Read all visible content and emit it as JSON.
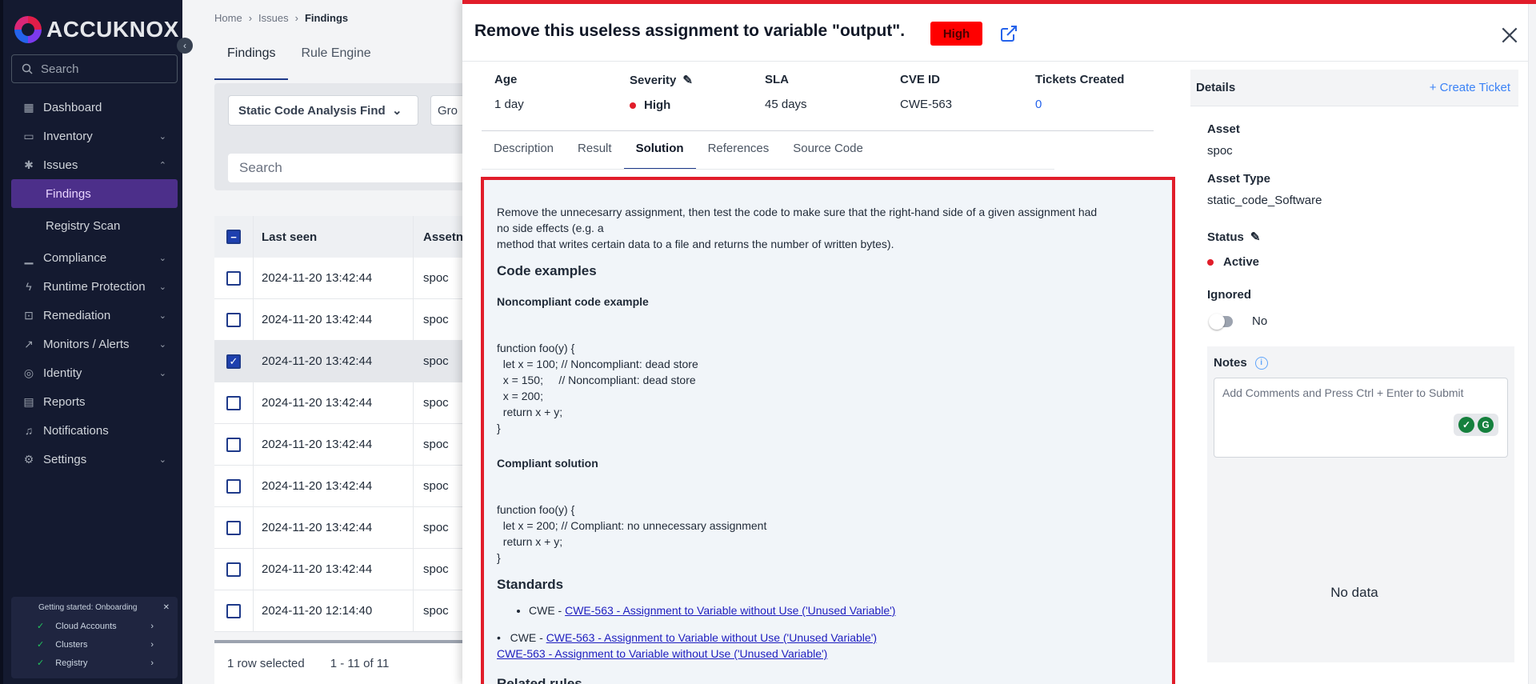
{
  "sidebar": {
    "logo": "ACCUKNOX",
    "search_placeholder": "Search",
    "items": [
      {
        "label": "Dashboard",
        "icon": "grid-icon"
      },
      {
        "label": "Inventory",
        "icon": "inventory-icon"
      },
      {
        "label": "Issues",
        "icon": "bug-icon"
      },
      {
        "label": "Findings",
        "icon": ""
      },
      {
        "label": "Registry Scan",
        "icon": ""
      },
      {
        "label": "Compliance",
        "icon": "chart-icon"
      },
      {
        "label": "Runtime Protection",
        "icon": "shield-icon"
      },
      {
        "label": "Remediation",
        "icon": "wrench-icon"
      },
      {
        "label": "Monitors / Alerts",
        "icon": "monitor-icon"
      },
      {
        "label": "Identity",
        "icon": "fingerprint-icon"
      },
      {
        "label": "Reports",
        "icon": "report-icon"
      },
      {
        "label": "Notifications",
        "icon": "bell-icon"
      },
      {
        "label": "Settings",
        "icon": "gear-icon"
      }
    ],
    "onboarding": {
      "title": "Getting started: Onboarding",
      "items": [
        "Cloud Accounts",
        "Clusters",
        "Registry"
      ]
    }
  },
  "page": {
    "breadcrumb": [
      "Home",
      "Issues",
      "Findings"
    ],
    "tabs": [
      "Findings",
      "Rule Engine"
    ],
    "filter": "Static Code Analysis Find",
    "filter2": "Gro",
    "search_placeholder": "Search",
    "columns": [
      "Last seen",
      "Assetn"
    ],
    "rows": [
      {
        "date": "2024-11-20 13:42:44",
        "asset": "spoc",
        "checked": false
      },
      {
        "date": "2024-11-20 13:42:44",
        "asset": "spoc",
        "checked": false
      },
      {
        "date": "2024-11-20 13:42:44",
        "asset": "spoc",
        "checked": true
      },
      {
        "date": "2024-11-20 13:42:44",
        "asset": "spoc",
        "checked": false
      },
      {
        "date": "2024-11-20 13:42:44",
        "asset": "spoc",
        "checked": false
      },
      {
        "date": "2024-11-20 13:42:44",
        "asset": "spoc",
        "checked": false
      },
      {
        "date": "2024-11-20 13:42:44",
        "asset": "spoc",
        "checked": false
      },
      {
        "date": "2024-11-20 13:42:44",
        "asset": "spoc",
        "checked": false
      },
      {
        "date": "2024-11-20 12:14:40",
        "asset": "spoc",
        "checked": false
      }
    ],
    "footer_selected": "1 row selected",
    "footer_range": "1 - 11 of 11"
  },
  "drawer": {
    "title": "Remove this useless assignment to variable \"output\".",
    "severity_badge": "High",
    "meta": {
      "age_label": "Age",
      "age": "1 day",
      "severity_label": "Severity",
      "severity": "High",
      "sla_label": "SLA",
      "sla": "45 days",
      "cve_label": "CVE ID",
      "cve": "CWE-563",
      "tickets_label": "Tickets Created",
      "tickets": "0"
    },
    "tabs": [
      "Description",
      "Result",
      "Solution",
      "References",
      "Source Code"
    ],
    "active_tab": "Solution",
    "solution": {
      "intro_1": "Remove the unnecesarry assignment, then test the code to make sure that the right-hand side of a given assignment had no side effects (e.g. a",
      "intro_2": "method that writes certain data to a file and returns the number of written bytes).",
      "h_code": "Code examples",
      "h_noncompliant": "Noncompliant code example",
      "code_noncompliant": "function foo(y) {\n  let x = 100; // Noncompliant: dead store\n  x = 150;     // Noncompliant: dead store\n  x = 200;\n  return x + y;\n}",
      "h_compliant": "Compliant solution",
      "code_compliant": "function foo(y) {\n  let x = 200; // Compliant: no unnecessary assignment\n  return x + y;\n}",
      "h_standards": "Standards",
      "std_prefix": "CWE - ",
      "std_link": "CWE-563 - Assignment to Variable without Use ('Unused Variable')",
      "h_related": "Related rules"
    },
    "details": {
      "title": "Details",
      "create_ticket": "+ Create Ticket",
      "asset_label": "Asset",
      "asset": "spoc",
      "asset_type_label": "Asset Type",
      "asset_type": "static_code_Software",
      "status_label": "Status",
      "status": "Active",
      "ignored_label": "Ignored",
      "ignored": "No",
      "notes_label": "Notes",
      "notes_placeholder": "Add Comments and Press Ctrl + Enter to Submit",
      "no_data": "No data"
    }
  }
}
